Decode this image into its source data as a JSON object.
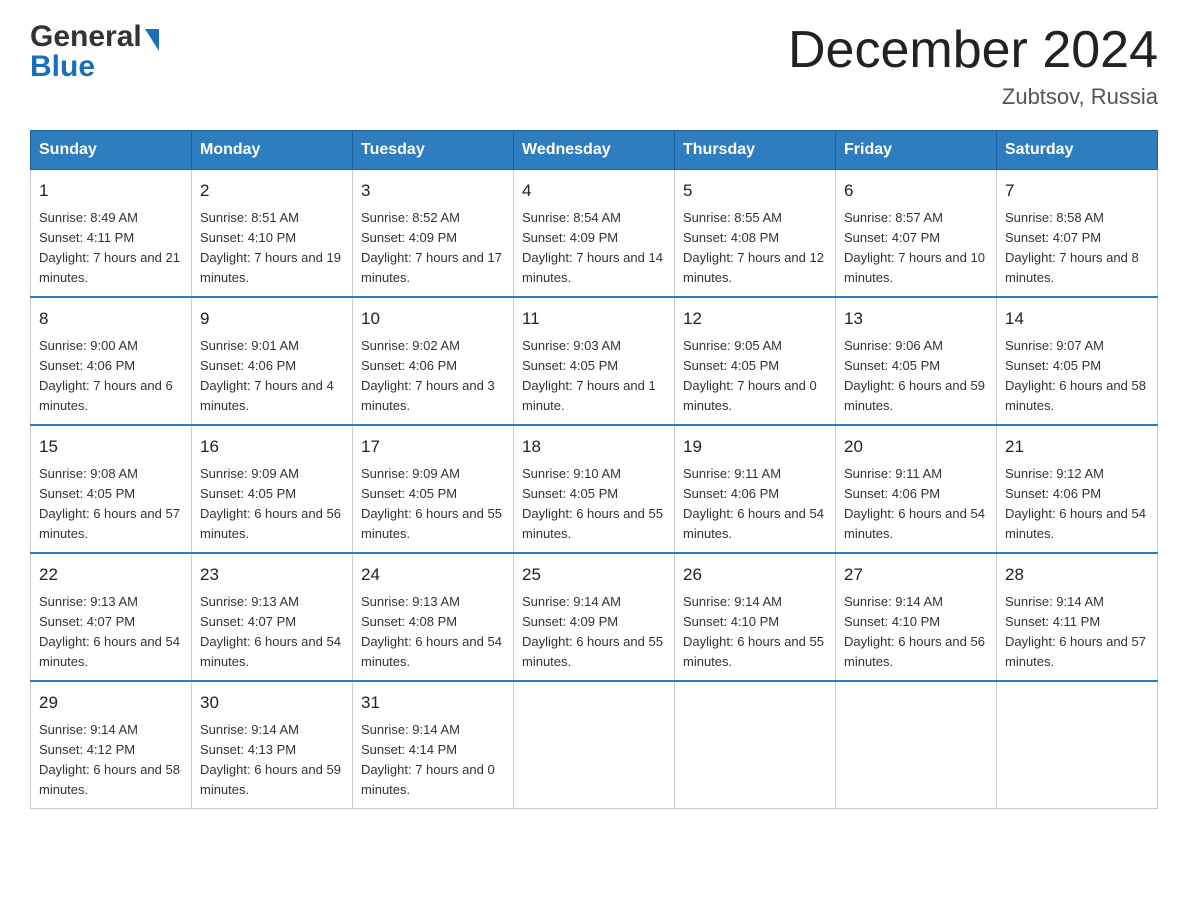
{
  "logo": {
    "general": "General",
    "blue": "Blue"
  },
  "title": "December 2024",
  "subtitle": "Zubtsov, Russia",
  "days_of_week": [
    "Sunday",
    "Monday",
    "Tuesday",
    "Wednesday",
    "Thursday",
    "Friday",
    "Saturday"
  ],
  "weeks": [
    [
      {
        "day": "1",
        "sunrise": "8:49 AM",
        "sunset": "4:11 PM",
        "daylight": "7 hours and 21 minutes."
      },
      {
        "day": "2",
        "sunrise": "8:51 AM",
        "sunset": "4:10 PM",
        "daylight": "7 hours and 19 minutes."
      },
      {
        "day": "3",
        "sunrise": "8:52 AM",
        "sunset": "4:09 PM",
        "daylight": "7 hours and 17 minutes."
      },
      {
        "day": "4",
        "sunrise": "8:54 AM",
        "sunset": "4:09 PM",
        "daylight": "7 hours and 14 minutes."
      },
      {
        "day": "5",
        "sunrise": "8:55 AM",
        "sunset": "4:08 PM",
        "daylight": "7 hours and 12 minutes."
      },
      {
        "day": "6",
        "sunrise": "8:57 AM",
        "sunset": "4:07 PM",
        "daylight": "7 hours and 10 minutes."
      },
      {
        "day": "7",
        "sunrise": "8:58 AM",
        "sunset": "4:07 PM",
        "daylight": "7 hours and 8 minutes."
      }
    ],
    [
      {
        "day": "8",
        "sunrise": "9:00 AM",
        "sunset": "4:06 PM",
        "daylight": "7 hours and 6 minutes."
      },
      {
        "day": "9",
        "sunrise": "9:01 AM",
        "sunset": "4:06 PM",
        "daylight": "7 hours and 4 minutes."
      },
      {
        "day": "10",
        "sunrise": "9:02 AM",
        "sunset": "4:06 PM",
        "daylight": "7 hours and 3 minutes."
      },
      {
        "day": "11",
        "sunrise": "9:03 AM",
        "sunset": "4:05 PM",
        "daylight": "7 hours and 1 minute."
      },
      {
        "day": "12",
        "sunrise": "9:05 AM",
        "sunset": "4:05 PM",
        "daylight": "7 hours and 0 minutes."
      },
      {
        "day": "13",
        "sunrise": "9:06 AM",
        "sunset": "4:05 PM",
        "daylight": "6 hours and 59 minutes."
      },
      {
        "day": "14",
        "sunrise": "9:07 AM",
        "sunset": "4:05 PM",
        "daylight": "6 hours and 58 minutes."
      }
    ],
    [
      {
        "day": "15",
        "sunrise": "9:08 AM",
        "sunset": "4:05 PM",
        "daylight": "6 hours and 57 minutes."
      },
      {
        "day": "16",
        "sunrise": "9:09 AM",
        "sunset": "4:05 PM",
        "daylight": "6 hours and 56 minutes."
      },
      {
        "day": "17",
        "sunrise": "9:09 AM",
        "sunset": "4:05 PM",
        "daylight": "6 hours and 55 minutes."
      },
      {
        "day": "18",
        "sunrise": "9:10 AM",
        "sunset": "4:05 PM",
        "daylight": "6 hours and 55 minutes."
      },
      {
        "day": "19",
        "sunrise": "9:11 AM",
        "sunset": "4:06 PM",
        "daylight": "6 hours and 54 minutes."
      },
      {
        "day": "20",
        "sunrise": "9:11 AM",
        "sunset": "4:06 PM",
        "daylight": "6 hours and 54 minutes."
      },
      {
        "day": "21",
        "sunrise": "9:12 AM",
        "sunset": "4:06 PM",
        "daylight": "6 hours and 54 minutes."
      }
    ],
    [
      {
        "day": "22",
        "sunrise": "9:13 AM",
        "sunset": "4:07 PM",
        "daylight": "6 hours and 54 minutes."
      },
      {
        "day": "23",
        "sunrise": "9:13 AM",
        "sunset": "4:07 PM",
        "daylight": "6 hours and 54 minutes."
      },
      {
        "day": "24",
        "sunrise": "9:13 AM",
        "sunset": "4:08 PM",
        "daylight": "6 hours and 54 minutes."
      },
      {
        "day": "25",
        "sunrise": "9:14 AM",
        "sunset": "4:09 PM",
        "daylight": "6 hours and 55 minutes."
      },
      {
        "day": "26",
        "sunrise": "9:14 AM",
        "sunset": "4:10 PM",
        "daylight": "6 hours and 55 minutes."
      },
      {
        "day": "27",
        "sunrise": "9:14 AM",
        "sunset": "4:10 PM",
        "daylight": "6 hours and 56 minutes."
      },
      {
        "day": "28",
        "sunrise": "9:14 AM",
        "sunset": "4:11 PM",
        "daylight": "6 hours and 57 minutes."
      }
    ],
    [
      {
        "day": "29",
        "sunrise": "9:14 AM",
        "sunset": "4:12 PM",
        "daylight": "6 hours and 58 minutes."
      },
      {
        "day": "30",
        "sunrise": "9:14 AM",
        "sunset": "4:13 PM",
        "daylight": "6 hours and 59 minutes."
      },
      {
        "day": "31",
        "sunrise": "9:14 AM",
        "sunset": "4:14 PM",
        "daylight": "7 hours and 0 minutes."
      },
      null,
      null,
      null,
      null
    ]
  ]
}
